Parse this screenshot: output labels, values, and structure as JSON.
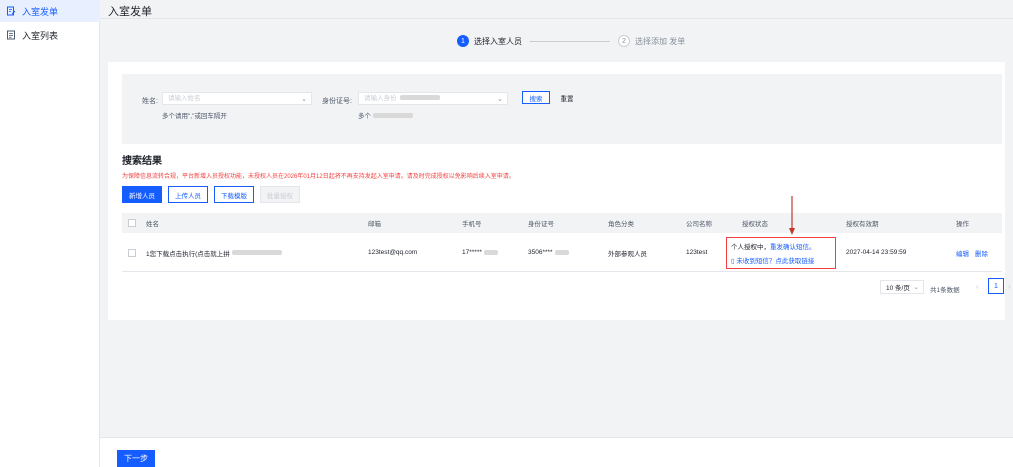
{
  "sidebar": {
    "items": [
      {
        "label": "入室发单",
        "icon": "document-edit-icon",
        "active": true
      },
      {
        "label": "入室列表",
        "icon": "document-list-icon",
        "active": false
      }
    ]
  },
  "page": {
    "title": "入室发单"
  },
  "steps": [
    {
      "num": "1",
      "label": "选择入室人员",
      "active": true
    },
    {
      "num": "2",
      "label": "选择添加 发单",
      "active": false
    }
  ],
  "filter": {
    "name_label": "姓名:",
    "name_placeholder": "请输入姓名",
    "name_hint": "多个请用\",\"或回车隔开",
    "id_label": "身份证号:",
    "id_placeholder": "请输入身份",
    "id_hint": "多个",
    "search_button": "搜索",
    "reset_button": "重置"
  },
  "results": {
    "title": "搜索结果",
    "notice": "为保障信息流转合规，平台新增入员授权功能，未授权人员在2026年01月12日起将不再支持发起入室申请。请及时完成授权以免影响后续入室申请。",
    "buttons": {
      "add": "新增人员",
      "upload": "上传人员",
      "download": "下载模版",
      "batch_auth": "批量授权"
    }
  },
  "table": {
    "headers": [
      "姓名",
      "邮箱",
      "手机号",
      "身份证号",
      "角色分类",
      "公司名称",
      "授权状态",
      "授权有效期",
      "操作"
    ],
    "rows": [
      {
        "name": "1您下载点击执行(点击就上拼",
        "email": "123test@qq.com",
        "phone": "17*****",
        "id_no": "3506****",
        "role": "外部参观人员",
        "company": "123test",
        "auth_status": "个人授权中，",
        "auth_resend": "重发确认短信。",
        "auth_missing": "未收到短信？点此获取链接",
        "auth_expiry": "2027-04-14 23:59:59",
        "edit": "编辑",
        "delete": "删除"
      }
    ]
  },
  "pagination": {
    "page_size": "10 条/页",
    "total": "共1条数据",
    "current": "1"
  },
  "footer": {
    "next_button": "下一步"
  }
}
